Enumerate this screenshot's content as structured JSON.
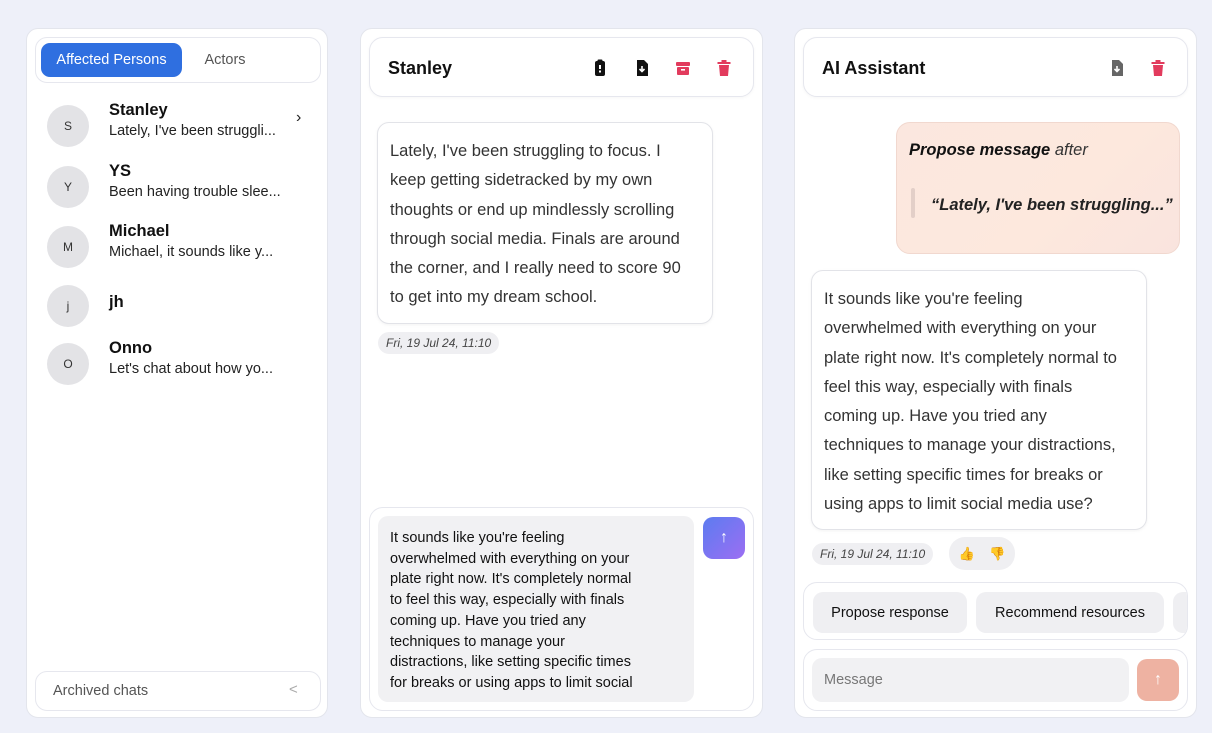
{
  "colors": {
    "background": "#eef0f9",
    "accent": "#2f6fe0",
    "danger": "#e23b5d",
    "send_gradient": [
      "#5c7cf0",
      "#9c6ef3"
    ],
    "send_disabled": "#eeb2a2"
  },
  "sidebar": {
    "tabs": [
      {
        "label": "Affected Persons",
        "active": true
      },
      {
        "label": "Actors",
        "active": false
      }
    ],
    "chats": [
      {
        "initial": "S",
        "name": "Stanley",
        "preview": "Lately, I've been struggli...",
        "selected": true
      },
      {
        "initial": "Y",
        "name": "YS",
        "preview": "Been having trouble slee..."
      },
      {
        "initial": "M",
        "name": "Michael",
        "preview": "Michael, it sounds like y..."
      },
      {
        "initial": "j",
        "name": "jh",
        "preview": ""
      },
      {
        "initial": "O",
        "name": "Onno",
        "preview": "Let's chat about how yo..."
      }
    ],
    "chevron": "›",
    "archived": {
      "label": "Archived chats",
      "arrow": "<"
    }
  },
  "chat": {
    "title": "Stanley",
    "header_icons": [
      "clipboard-icon",
      "file-download-icon",
      "archive-icon",
      "trash-icon"
    ],
    "message": {
      "lines": [
        "Lately, I've been struggling to focus. I",
        "keep getting sidetracked by my own",
        "thoughts or end up mindlessly scrolling",
        "through social media. Finals are around",
        "the corner, and I really need to score 90",
        "to get into my dream school."
      ],
      "timestamp": "Fri, 19 Jul 24, 11:10"
    },
    "draft_lines": [
      "It sounds like you're feeling",
      "overwhelmed with everything on your",
      "plate right now. It's completely normal",
      "to feel this way, especially with finals",
      "coming up. Have you tried any",
      "techniques to manage your",
      "distractions, like setting specific times",
      "for breaks or using apps to limit social"
    ],
    "send_icon": "↑"
  },
  "assistant": {
    "title": "AI Assistant",
    "header_icons": [
      "file-download-icon",
      "trash-icon"
    ],
    "propose": {
      "bold": "Propose message",
      "rest": " after",
      "quote": "“Lately, I've been struggling...”"
    },
    "reply": {
      "lines": [
        "It sounds like you're feeling",
        "overwhelmed with everything on your",
        "plate right now. It's completely normal to",
        "feel this way, especially with finals",
        "coming up. Have you tried any",
        "techniques to manage your distractions,",
        "like setting specific times for breaks or",
        "using apps to limit social media use?"
      ],
      "timestamp": "Fri, 19 Jul 24, 11:10"
    },
    "feedback": {
      "up": "👍",
      "down": "👎"
    },
    "actions": [
      "Propose response",
      "Recommend resources",
      ""
    ],
    "input_placeholder": "Message",
    "send_icon": "↑"
  }
}
